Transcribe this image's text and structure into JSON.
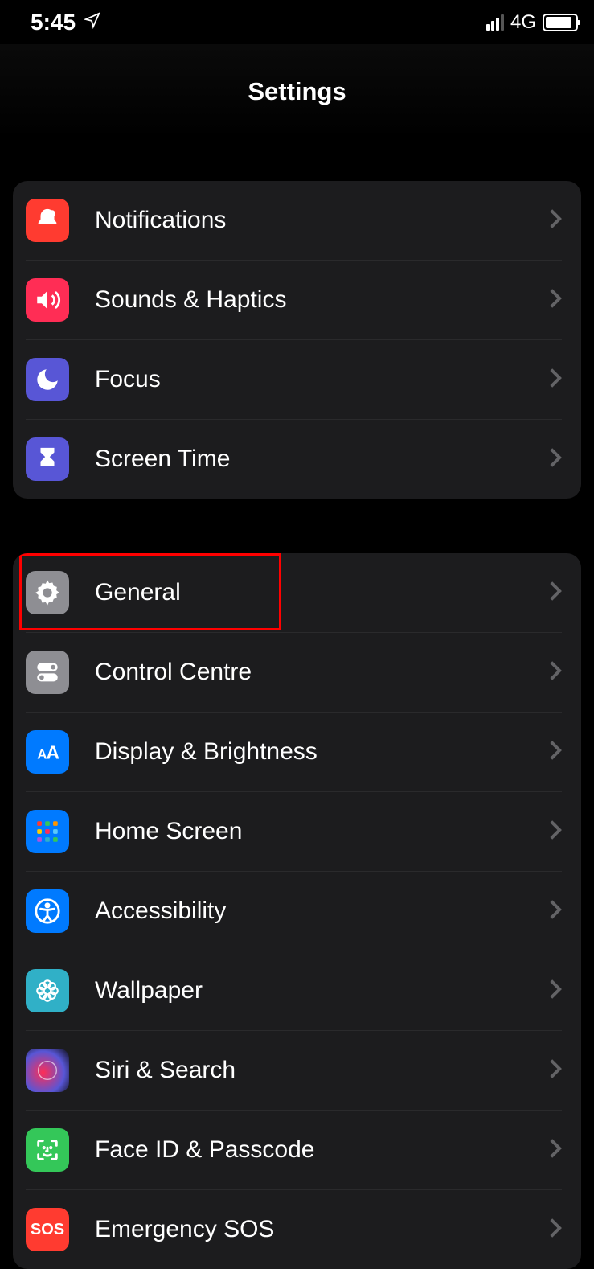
{
  "status": {
    "time": "5:45",
    "network_label": "4G"
  },
  "header": {
    "title": "Settings"
  },
  "group1": {
    "items": [
      {
        "label": "Notifications"
      },
      {
        "label": "Sounds & Haptics"
      },
      {
        "label": "Focus"
      },
      {
        "label": "Screen Time"
      }
    ]
  },
  "group2": {
    "items": [
      {
        "label": "General"
      },
      {
        "label": "Control Centre"
      },
      {
        "label": "Display & Brightness"
      },
      {
        "label": "Home Screen"
      },
      {
        "label": "Accessibility"
      },
      {
        "label": "Wallpaper"
      },
      {
        "label": "Siri & Search"
      },
      {
        "label": "Face ID & Passcode"
      },
      {
        "label": "Emergency SOS"
      }
    ],
    "sos_text": "SOS"
  }
}
